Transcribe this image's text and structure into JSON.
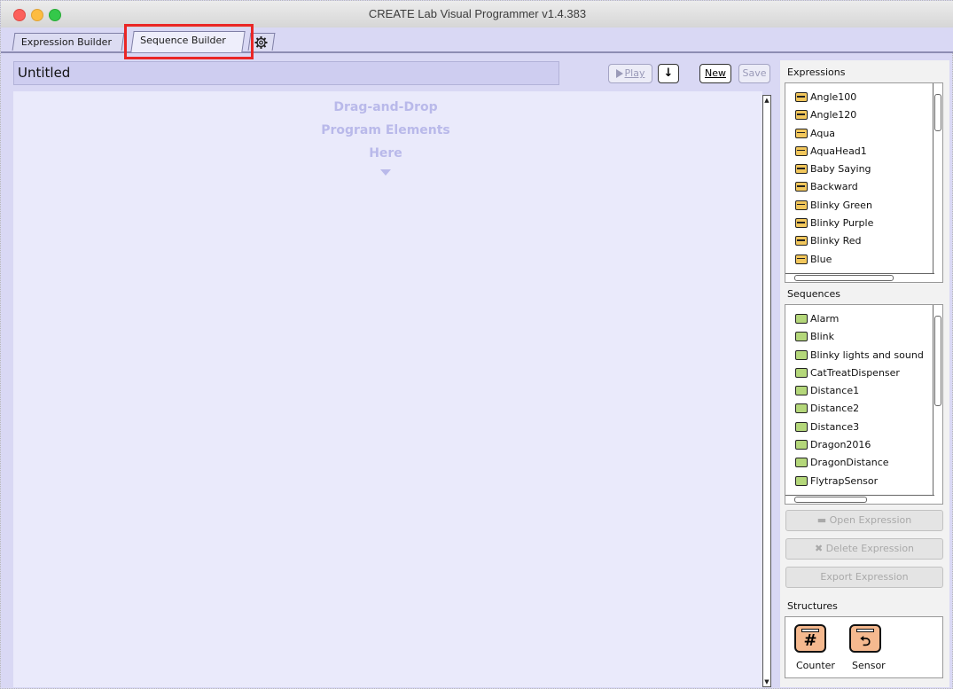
{
  "window": {
    "title": "CREATE Lab Visual Programmer v1.4.383"
  },
  "tabs": [
    {
      "label": "Expression Builder"
    },
    {
      "label": "Sequence Builder",
      "selected": true
    },
    {
      "icon": "gear-icon"
    }
  ],
  "editor": {
    "name": "Untitled",
    "play_label": "Play",
    "down_label": "↓",
    "new_label": "New",
    "save_label": "Save",
    "hint": [
      "Drag-and-Drop",
      "Program Elements",
      "Here"
    ]
  },
  "expressions": {
    "label": "Expressions",
    "items": [
      "Angle100",
      "Angle120",
      "Aqua",
      "AquaHead1",
      "Baby Saying",
      "Backward",
      "Blinky Green",
      "Blinky Purple",
      "Blinky Red",
      "Blue"
    ]
  },
  "sequences": {
    "label": "Sequences",
    "items": [
      "Alarm",
      "Blink",
      "Blinky lights and sound",
      "CatTreatDispenser",
      "Distance1",
      "Distance2",
      "Distance3",
      "Dragon2016",
      "DragonDistance",
      "FlytrapSensor"
    ]
  },
  "actions": {
    "open": "Open Expression",
    "delete": "Delete Expression",
    "export": "Export Expression"
  },
  "structures": {
    "label": "Structures",
    "items": [
      {
        "label": "Counter",
        "glyph": "#"
      },
      {
        "label": "Sensor",
        "glyph": "⮌"
      }
    ]
  },
  "colors": {
    "highlight": "#ea2626",
    "expression_icon": "#f2c75c",
    "sequence_icon": "#b4d77a",
    "structure_icon": "#f5b98f"
  }
}
